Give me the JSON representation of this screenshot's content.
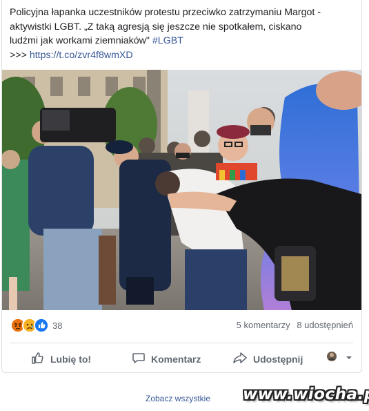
{
  "post": {
    "line1": "Policyjna łapanka uczestników protestu przeciwko zatrzymaniu Margot -",
    "line2": "aktywistki LGBT. „Z taką agresją się jeszcze nie spotkałem, ciskano",
    "line3_text": "ludźmi jak workami ziemniaków\" ",
    "hashtag": "#LGBT",
    "link_prefix": ">>> ",
    "link": "https://t.co/zvr4f8wmXD"
  },
  "photo": {
    "description_icon": "protest-photo"
  },
  "stats": {
    "reaction_icons": [
      "angry-reaction-icon",
      "sad-reaction-icon",
      "like-reaction-icon"
    ],
    "reaction_count": "38",
    "comments": "5 komentarzy",
    "shares": "8 udostępnień"
  },
  "actions": {
    "like": "Lubię to!",
    "comment": "Komentarz",
    "share": "Udostępnij"
  },
  "footer": {
    "see_all": "Zobacz wszystkie",
    "watermark": "www.wiocha.pl"
  },
  "colors": {
    "link": "#385898",
    "text": "#1c1e21",
    "muted": "#606770",
    "like_blue": "#1877f2",
    "angry_orange": "#e9710f",
    "sad_yellow": "#f7b125"
  }
}
